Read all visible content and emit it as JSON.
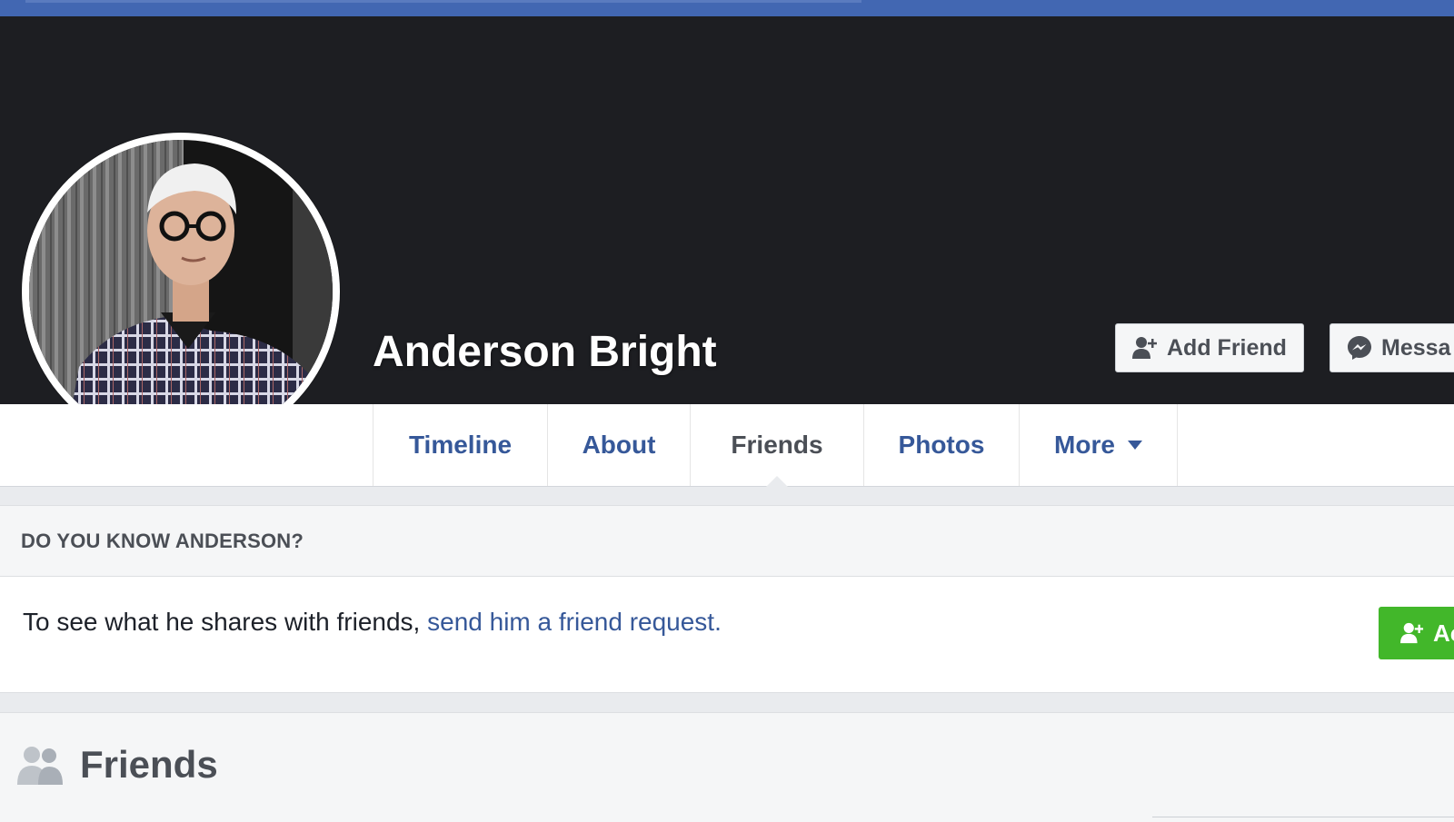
{
  "profile": {
    "name": "Anderson Bright"
  },
  "cover_buttons": {
    "add_friend_label": "Add Friend",
    "message_label": "Messa",
    "add_friend_icon": "add-friend-icon",
    "message_icon": "messenger-icon"
  },
  "tabs": [
    {
      "label": "Timeline",
      "active": false
    },
    {
      "label": "About",
      "active": false
    },
    {
      "label": "Friends",
      "active": true
    },
    {
      "label": "Photos",
      "active": false
    },
    {
      "label": "More",
      "active": false
    }
  ],
  "know_card": {
    "header": "DO YOU KNOW ANDERSON?",
    "body_text": "To see what he shares with friends, ",
    "link_text": "send him a friend request.",
    "button_label": "Ac"
  },
  "friends_section": {
    "title": "Friends",
    "icon": "friends-icon"
  },
  "colors": {
    "facebook_blue": "#4267b2",
    "link_blue": "#365899",
    "green": "#42b72a",
    "cover": "#1d1e22"
  }
}
